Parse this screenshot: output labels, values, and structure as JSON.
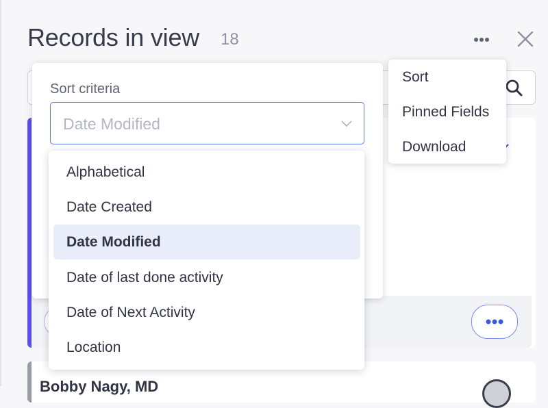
{
  "header": {
    "title": "Records in view",
    "count": "18"
  },
  "sort": {
    "label": "Sort criteria",
    "selected_value": "Date Modified",
    "options": [
      {
        "label": "Alphabetical"
      },
      {
        "label": "Date Created"
      },
      {
        "label": "Date Modified",
        "selected": true
      },
      {
        "label": "Date of last done activity"
      },
      {
        "label": "Date of Next Activity"
      },
      {
        "label": "Location"
      }
    ]
  },
  "overflow_menu": {
    "items": [
      {
        "label": "Sort"
      },
      {
        "label": "Pinned Fields"
      },
      {
        "label": "Download"
      }
    ]
  },
  "second_record": {
    "name_partial": "Bobby Nagy, MD"
  },
  "icons": {
    "kebab": "more-horizontal-icon",
    "close": "close-icon",
    "search": "search-icon",
    "chevron": "chevron-down-icon"
  },
  "colors": {
    "accent": "#5b4fe8",
    "select_border": "#5b7ae6",
    "selected_option_bg": "#e9ecf9"
  }
}
